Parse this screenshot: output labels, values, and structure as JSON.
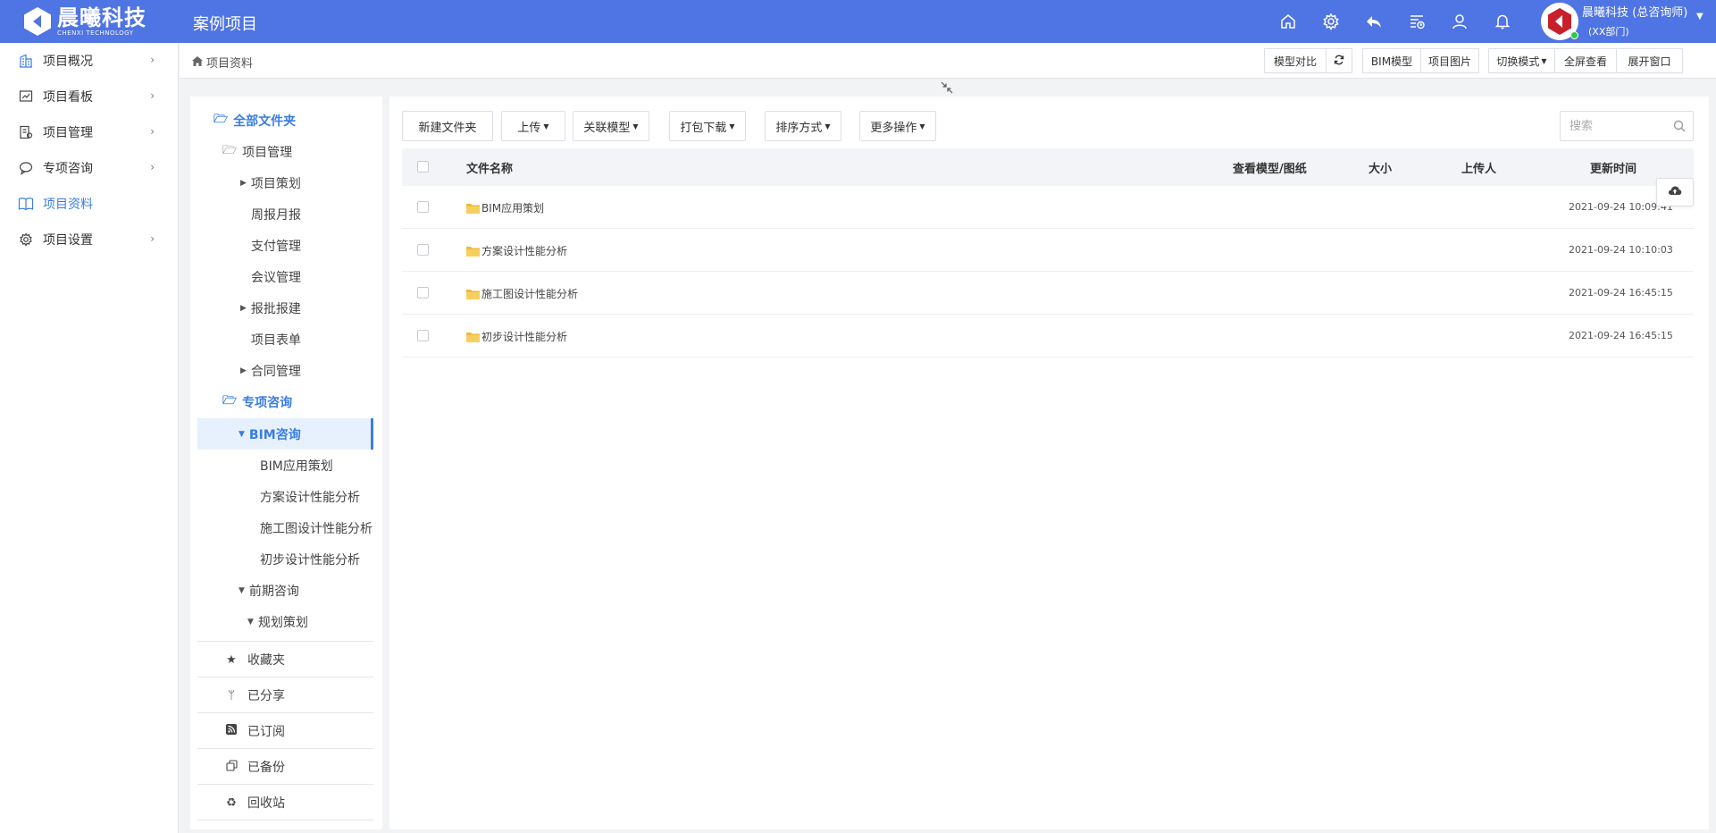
{
  "header": {
    "brand_cn": "晨曦科技",
    "brand_en": "CHENXI TECHNOLOGY",
    "app_title": "案例项目",
    "icons": [
      "home-icon",
      "settings-icon",
      "reply-icon",
      "list-clock-icon",
      "user-icon",
      "bell-icon"
    ],
    "user_name": "晨曦科技 (总咨询师)",
    "user_dept": "(XX部门)"
  },
  "leftnav": {
    "items": [
      {
        "label": "项目概况",
        "icon": "building-icon",
        "has_arrow": true,
        "active": false
      },
      {
        "label": "项目看板",
        "icon": "chart-board-icon",
        "has_arrow": true,
        "active": false
      },
      {
        "label": "项目管理",
        "icon": "manage-icon",
        "has_arrow": true,
        "active": false
      },
      {
        "label": "专项咨询",
        "icon": "chat-icon",
        "has_arrow": true,
        "active": false
      },
      {
        "label": "项目资料",
        "icon": "book-icon",
        "has_arrow": false,
        "active": true
      },
      {
        "label": "项目设置",
        "icon": "settings-icon",
        "has_arrow": true,
        "active": false
      }
    ]
  },
  "breadcrumb": {
    "label": "项目资料"
  },
  "toolbar": {
    "compare": "模型对比",
    "refresh_icon": "refresh-icon",
    "bim_model": "BIM模型",
    "project_images": "项目图片",
    "switch_mode": "切换模式",
    "fullscreen": "全屏查看",
    "open_window": "展开窗口"
  },
  "tree": {
    "root": "全部文件夹",
    "project_mgmt": "项目管理",
    "project_plan": "项目策划",
    "weekly_report": "周报月报",
    "payment": "支付管理",
    "meeting": "会议管理",
    "approval": "报批报建",
    "forms": "项目表单",
    "contracts": "合同管理",
    "special": "专项咨询",
    "bim_consult": "BIM咨询",
    "bim_plan": "BIM应用策划",
    "scheme_perf": "方案设计性能分析",
    "construction_perf": "施工图设计性能分析",
    "prelim_perf": "初步设计性能分析",
    "early_consult": "前期咨询",
    "planning": "规划策划"
  },
  "utilities": [
    {
      "label": "收藏夹",
      "icon": "star-icon"
    },
    {
      "label": "已分享",
      "icon": "share-icon"
    },
    {
      "label": "已订阅",
      "icon": "rss-icon"
    },
    {
      "label": "已备份",
      "icon": "backup-icon"
    },
    {
      "label": "回收站",
      "icon": "recycle-icon"
    }
  ],
  "actions": {
    "new_folder": "新建文件夹",
    "upload": "上传",
    "link_model": "关联模型",
    "pack_download": "打包下载",
    "sort": "排序方式",
    "more": "更多操作"
  },
  "search": {
    "placeholder": "搜索"
  },
  "table": {
    "columns": {
      "name": "文件名称",
      "view": "查看模型/图纸",
      "size": "大小",
      "uploader": "上传人",
      "updated": "更新时间"
    },
    "rows": [
      {
        "name": "BIM应用策划",
        "updated": "2021-09-24 10:09:41"
      },
      {
        "name": "方案设计性能分析",
        "updated": "2021-09-24 10:10:03"
      },
      {
        "name": "施工图设计性能分析",
        "updated": "2021-09-24 16:45:15"
      },
      {
        "name": "初步设计性能分析",
        "updated": "2021-09-24 16:45:15"
      }
    ]
  },
  "colors": {
    "primary": "#4f74e3",
    "accent": "#3a7de0",
    "active_bg": "#e6f1fd",
    "folder": "#f5c443"
  }
}
